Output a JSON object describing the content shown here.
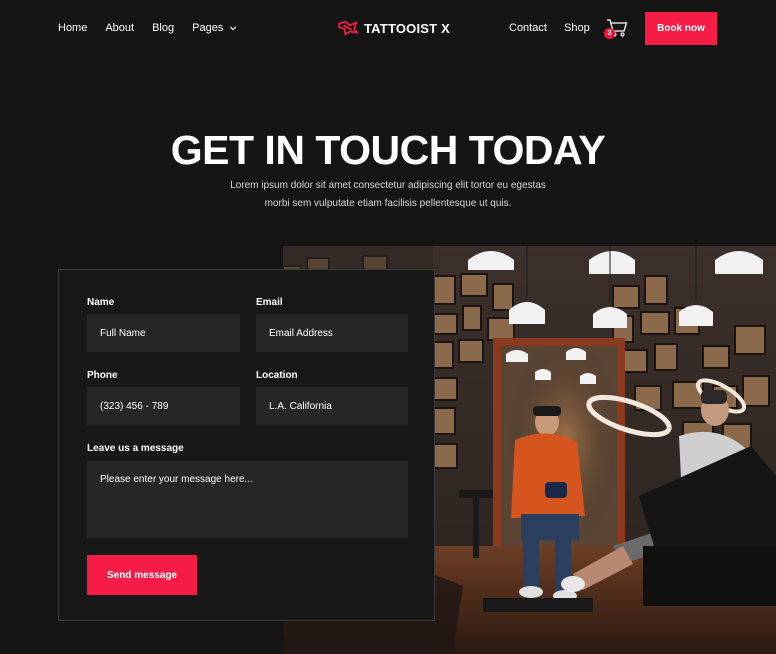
{
  "nav": {
    "left_links": [
      "Home",
      "About",
      "Blog",
      "Pages"
    ],
    "right_links": [
      "Contact",
      "Shop"
    ],
    "logo_text": "TATTOOIST X",
    "cart_count": "3",
    "book_label": "Book now"
  },
  "hero": {
    "title": "GET IN TOUCH TODAY",
    "subtitle_line1": "Lorem ipsum dolor sit amet consectetur adipiscing elit tortor eu egestas",
    "subtitle_line2": "morbi sem vulputate etiam facilisis pellentesque ut quis."
  },
  "form": {
    "name_label": "Name",
    "name_placeholder": "Full Name",
    "email_label": "Email",
    "email_placeholder": "Email Address",
    "phone_label": "Phone",
    "phone_value": "(323) 456 - 789",
    "location_label": "Location",
    "location_value": "L.A. California",
    "message_label": "Leave us a message",
    "message_placeholder": "Please enter your message here...",
    "send_label": "Send message"
  },
  "colors": {
    "background": "#151515",
    "accent": "#f51d45",
    "field_bg": "#262626"
  },
  "icons": {
    "logo": "tattoo-logo-icon",
    "dropdown": "chevron-down-icon",
    "cart": "shopping-cart-icon"
  }
}
